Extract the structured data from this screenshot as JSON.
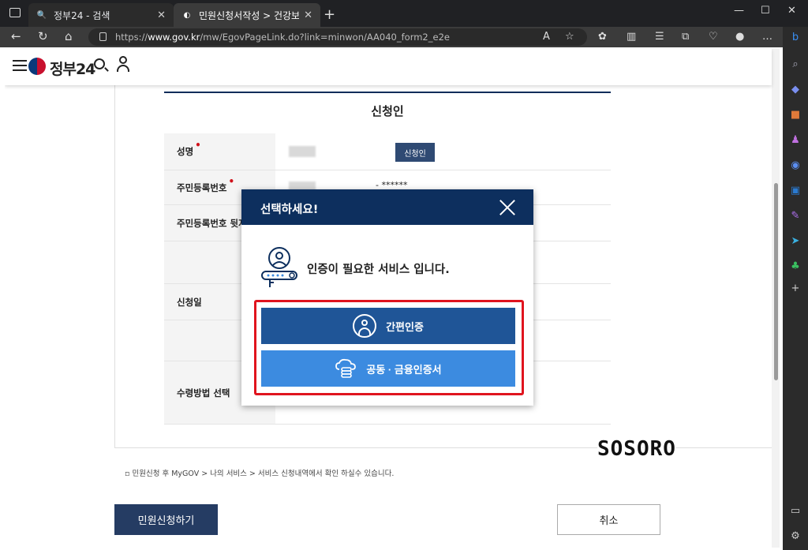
{
  "browser": {
    "tabs": [
      {
        "title": "정부24 - 검색",
        "active": false
      },
      {
        "title": "민원신청서작성 > 건강보험 자격",
        "active": true
      }
    ],
    "url_prefix": "https://",
    "url_host": "www.gov.kr",
    "url_path": "/mw/EgovPageLink.do?link=minwon/AA040_form2_e2e"
  },
  "header": {
    "logo_text": "정부24"
  },
  "form": {
    "section_title": "신청인",
    "rows": [
      {
        "label": "성명",
        "required": true
      },
      {
        "label": "주민등록번호",
        "required": true
      },
      {
        "label": "주민등록번호 뒷자리",
        "required": false
      },
      {
        "label": "",
        "required": false
      },
      {
        "label": "신청일",
        "required": false
      },
      {
        "label": "",
        "required": false
      },
      {
        "label": "수령방법 선택",
        "required": false
      }
    ],
    "applicant_button": "신청인",
    "ssn_mask": "- ******",
    "note": "민원신청 후 MyGOV > 나의 서비스 > 서비스 신청내역에서 확인 하실수 있습니다.",
    "submit_label": "민원신청하기",
    "cancel_label": "취소"
  },
  "modal": {
    "title": "선택하세요!",
    "message": "인증이 필요한 서비스 입니다.",
    "option_simple": "간편인증",
    "option_cert": "공동 · 금융인증서",
    "highlight_color": "#e0141e"
  },
  "watermark": "SOSORO"
}
